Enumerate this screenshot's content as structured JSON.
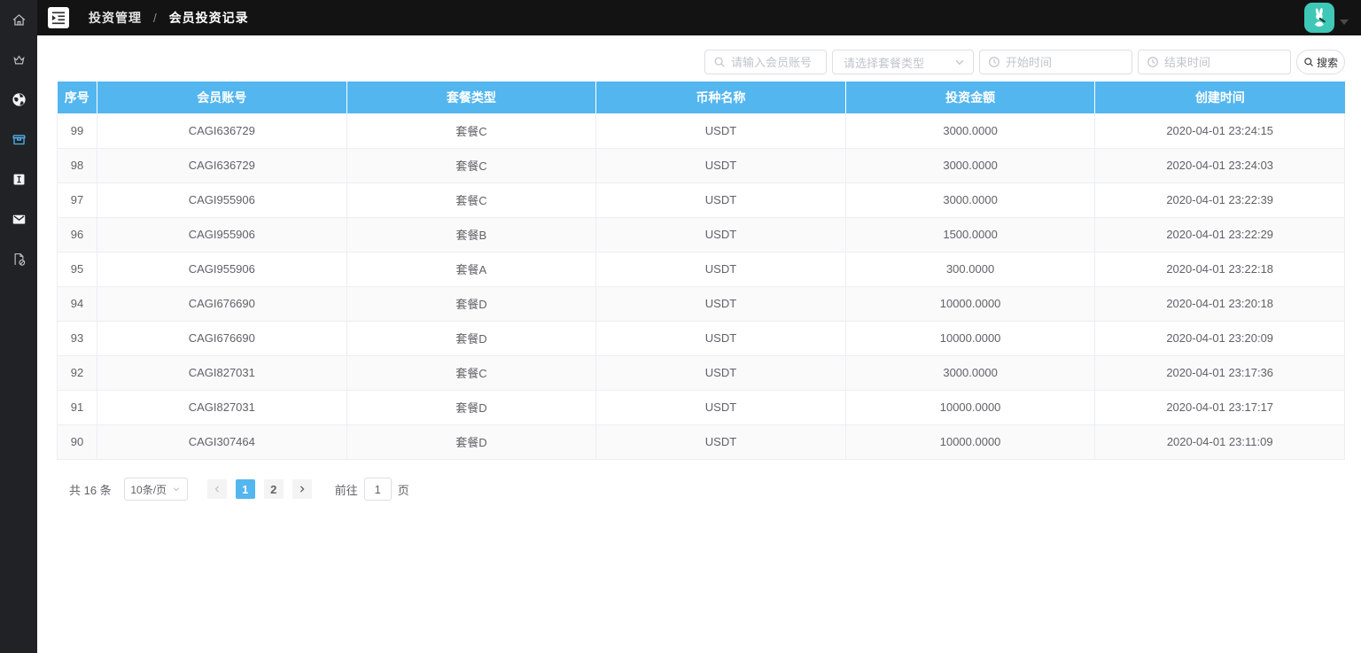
{
  "topbar": {
    "breadcrumb": {
      "first": "投资管理",
      "separator": "/",
      "last": "会员投资记录"
    },
    "avatar_icon": "rabbit-guitar-avatar",
    "accent_teal": "#3fc8b7"
  },
  "sidebar": {
    "items": [
      {
        "icon": "home-icon",
        "active": false
      },
      {
        "icon": "crown-icon",
        "active": false
      },
      {
        "icon": "globe-icon",
        "active": false
      },
      {
        "icon": "storage-box-icon",
        "active": true
      },
      {
        "icon": "info-icon",
        "active": false
      },
      {
        "icon": "mail-icon",
        "active": false
      },
      {
        "icon": "export-icon",
        "active": false
      }
    ],
    "active_color": "#4fb0e8"
  },
  "filters": {
    "account_placeholder": "请输入会员账号",
    "package_placeholder": "请选择套餐类型",
    "start_time_placeholder": "开始时间",
    "end_time_placeholder": "结束时间",
    "search_label": "搜索"
  },
  "table": {
    "header_color": "#53b6ef",
    "headers": [
      "序号",
      "会员账号",
      "套餐类型",
      "币种名称",
      "投资金额",
      "创建时间"
    ],
    "rows": [
      [
        "99",
        "CAGI636729",
        "套餐C",
        "USDT",
        "3000.0000",
        "2020-04-01 23:24:15"
      ],
      [
        "98",
        "CAGI636729",
        "套餐C",
        "USDT",
        "3000.0000",
        "2020-04-01 23:24:03"
      ],
      [
        "97",
        "CAGI955906",
        "套餐C",
        "USDT",
        "3000.0000",
        "2020-04-01 23:22:39"
      ],
      [
        "96",
        "CAGI955906",
        "套餐B",
        "USDT",
        "1500.0000",
        "2020-04-01 23:22:29"
      ],
      [
        "95",
        "CAGI955906",
        "套餐A",
        "USDT",
        "300.0000",
        "2020-04-01 23:22:18"
      ],
      [
        "94",
        "CAGI676690",
        "套餐D",
        "USDT",
        "10000.0000",
        "2020-04-01 23:20:18"
      ],
      [
        "93",
        "CAGI676690",
        "套餐D",
        "USDT",
        "10000.0000",
        "2020-04-01 23:20:09"
      ],
      [
        "92",
        "CAGI827031",
        "套餐C",
        "USDT",
        "3000.0000",
        "2020-04-01 23:17:36"
      ],
      [
        "91",
        "CAGI827031",
        "套餐D",
        "USDT",
        "10000.0000",
        "2020-04-01 23:17:17"
      ],
      [
        "90",
        "CAGI307464",
        "套餐D",
        "USDT",
        "10000.0000",
        "2020-04-01 23:11:09"
      ]
    ]
  },
  "pagination": {
    "total_label": "共 16 条",
    "page_size_label": "10条/页",
    "pages": [
      "1",
      "2"
    ],
    "active_page": "1",
    "goto_label": "前往",
    "goto_value": "1",
    "page_suffix": "页"
  }
}
